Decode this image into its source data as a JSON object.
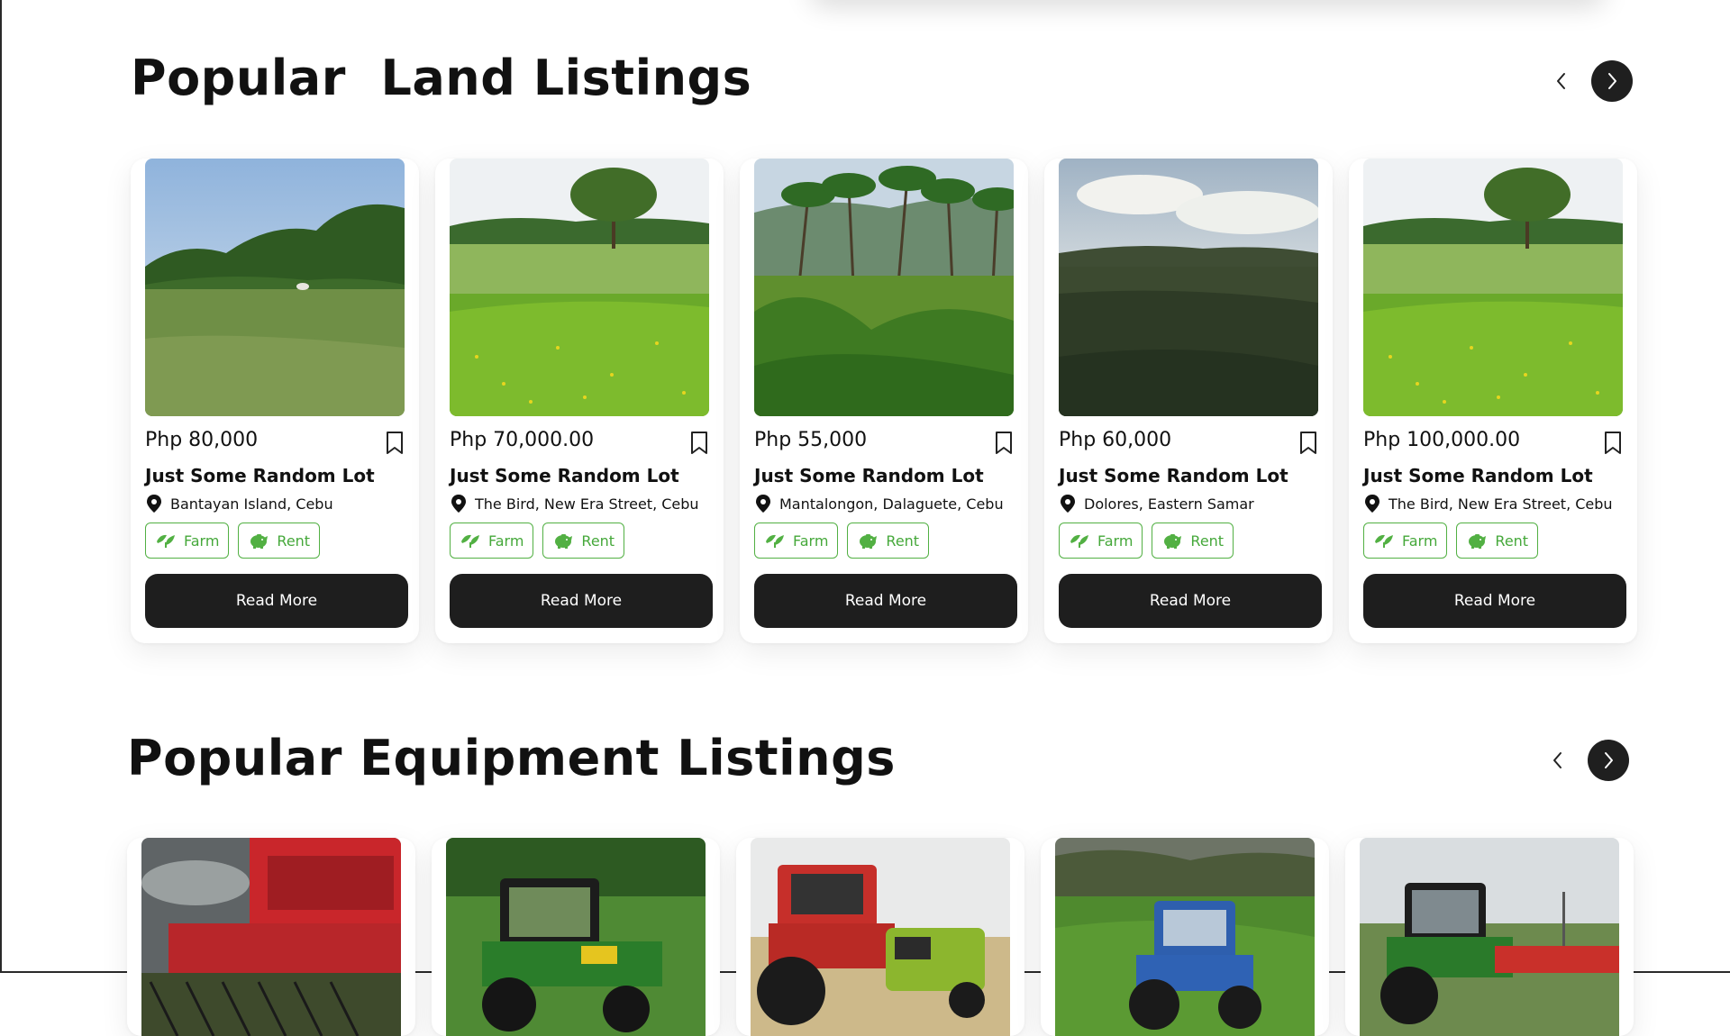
{
  "land_section": {
    "title": "Popular  Land Listings",
    "prev_icon": "chevron-left-icon",
    "next_icon": "chevron-right-icon",
    "cards": [
      {
        "price": "Php 80,000",
        "name": "Just Some Random Lot",
        "location": "Bantayan Island, Cebu",
        "tags": [
          "Farm",
          "Rent"
        ],
        "button": "Read More",
        "image": "grass field with cow and tree line"
      },
      {
        "price": "Php 70,000.00",
        "name": "Just Some Random Lot",
        "location": "The Bird, New Era Street, Cebu",
        "tags": [
          "Farm",
          "Rent"
        ],
        "button": "Read More",
        "image": "green field with lone tree"
      },
      {
        "price": "Php 55,000",
        "name": "Just Some Random Lot",
        "location": "Mantalongon, Dalaguete, Cebu",
        "tags": [
          "Farm",
          "Rent"
        ],
        "button": "Read More",
        "image": "coconut palm grove"
      },
      {
        "price": "Php 60,000",
        "name": "Just Some Random Lot",
        "location": "Dolores, Eastern Samar",
        "tags": [
          "Farm",
          "Rent"
        ],
        "button": "Read More",
        "image": "dark field under cloudy sky"
      },
      {
        "price": "Php 100,000.00",
        "name": "Just Some Random Lot",
        "location": "The Bird, New Era Street, Cebu",
        "tags": [
          "Farm",
          "Rent"
        ],
        "button": "Read More",
        "image": "green field with lone tree"
      }
    ]
  },
  "equipment_section": {
    "title": "Popular Equipment Listings",
    "prev_icon": "chevron-left-icon",
    "next_icon": "chevron-right-icon",
    "cards": [
      {
        "image": "red combine harvester"
      },
      {
        "image": "green tractor in field"
      },
      {
        "image": "red tractor with green baler"
      },
      {
        "image": "blue tractor in field"
      },
      {
        "image": "green tractor with red implement"
      }
    ]
  },
  "colors": {
    "accent_green": "#52b043",
    "button_dark": "#1e1e1e",
    "background": "#ffffff"
  }
}
